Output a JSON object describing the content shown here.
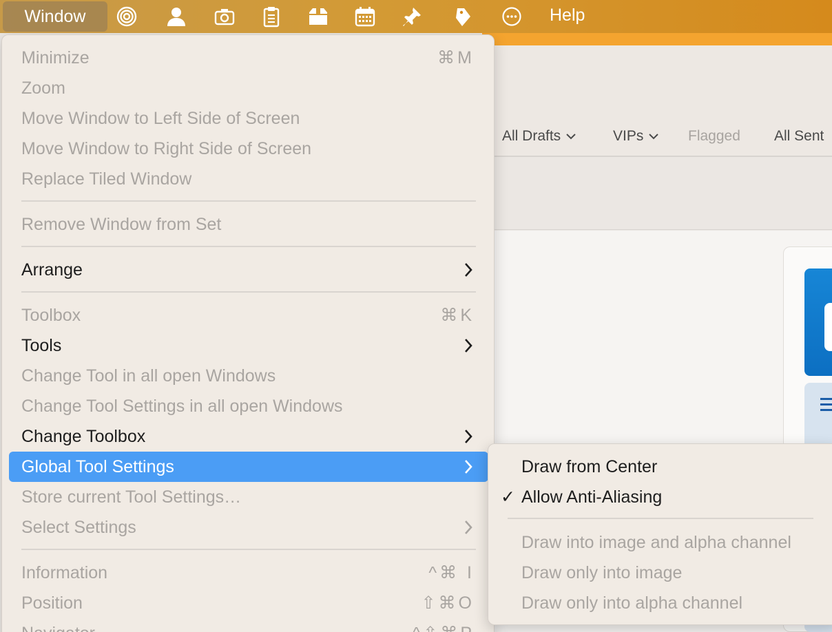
{
  "menubar": {
    "window_label": "Window",
    "help_label": "Help",
    "icons": [
      "target-icon",
      "person-icon",
      "camera-icon",
      "clipboard-icon",
      "box-icon",
      "calendar-icon",
      "pin-icon",
      "tag-icon",
      "ellipsis-circle-icon"
    ]
  },
  "background": {
    "tabs": [
      {
        "label": "All Drafts",
        "chevron": true,
        "dim": false
      },
      {
        "label": "VIPs",
        "chevron": true,
        "dim": false
      },
      {
        "label": "Flagged",
        "chevron": false,
        "dim": true
      },
      {
        "label": "All Sent",
        "chevron": false,
        "dim": false
      }
    ]
  },
  "menu": {
    "items": [
      {
        "label": "Minimize",
        "shortcut": "⌘M",
        "disabled": true
      },
      {
        "label": "Zoom",
        "disabled": true
      },
      {
        "label": "Move Window to Left Side of Screen",
        "disabled": true
      },
      {
        "label": "Move Window to Right Side of Screen",
        "disabled": true
      },
      {
        "label": "Replace Tiled Window",
        "disabled": true
      },
      {
        "label": "Remove Window from Set",
        "disabled": true
      },
      {
        "label": "Arrange",
        "submenu": true,
        "disabled": false
      },
      {
        "label": "Toolbox",
        "shortcut": "⌘K",
        "disabled": true
      },
      {
        "label": "Tools",
        "submenu": true,
        "disabled": false
      },
      {
        "label": "Change Tool in all open Windows",
        "disabled": true
      },
      {
        "label": "Change Tool Settings in all open Windows",
        "disabled": true
      },
      {
        "label": "Change Toolbox",
        "submenu": true,
        "disabled": false
      },
      {
        "label": "Global Tool Settings",
        "submenu": true,
        "disabled": false,
        "active": true
      },
      {
        "label": "Store current Tool Settings…",
        "disabled": true
      },
      {
        "label": "Select Settings",
        "submenu": true,
        "disabled": true
      },
      {
        "label": "Information",
        "shortcut": "^⌘ I",
        "disabled": true
      },
      {
        "label": "Position",
        "shortcut": "⇧⌘O",
        "disabled": true
      },
      {
        "label": "Navigator",
        "shortcut": "^⇧⌘P",
        "disabled": true
      }
    ]
  },
  "submenu": {
    "items": [
      {
        "label": "Draw from Center",
        "checked": false,
        "disabled": false
      },
      {
        "label": "Allow Anti-Aliasing",
        "checked": true,
        "disabled": false
      },
      {
        "label": "Draw into image and alpha channel",
        "checked": false,
        "disabled": true
      },
      {
        "label": "Draw only into image",
        "checked": false,
        "disabled": true
      },
      {
        "label": "Draw only into alpha channel",
        "checked": false,
        "disabled": true
      }
    ],
    "check_glyph": "✓"
  },
  "colors": {
    "highlight": "#4b9df5",
    "menubar_orange": "#d58a1c",
    "disabled_text": "#a9a5a1"
  }
}
